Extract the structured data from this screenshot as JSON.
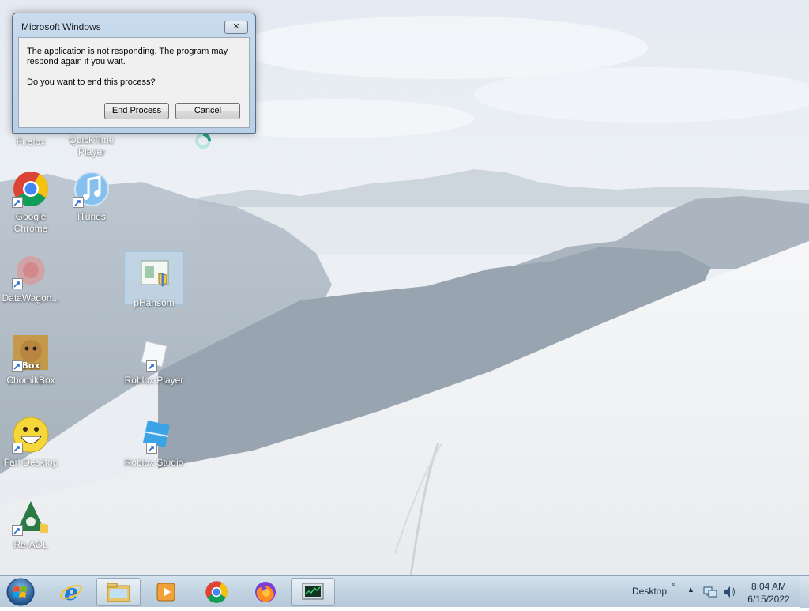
{
  "dialog": {
    "title": "Microsoft Windows",
    "close_label": "✕",
    "message": "The application is not responding. The program may respond again if you wait.",
    "question": "Do you want to end this process?",
    "end_process_label": "End Process",
    "cancel_label": "Cancel"
  },
  "desktop_icons": [
    {
      "label": "Firefox",
      "icon": "firefox-icon"
    },
    {
      "label": "QuickTime Player",
      "icon": "quicktime-icon"
    },
    {
      "label": "Google Chrome",
      "icon": "chrome-icon"
    },
    {
      "label": "iTunes",
      "icon": "itunes-icon"
    },
    {
      "label": "DataWagon...",
      "icon": "datawagon-icon"
    },
    {
      "label": "pHansom",
      "icon": "phansom-icon"
    },
    {
      "label": "ChomikBox",
      "icon": "chomikbox-icon"
    },
    {
      "label": "Roblox Player",
      "icon": "roblox-player-icon"
    },
    {
      "label": "Fart Desktop",
      "icon": "smiley-icon"
    },
    {
      "label": "Roblox Studio",
      "icon": "roblox-studio-icon"
    },
    {
      "label": "Re-AOL",
      "icon": "aol-icon"
    }
  ],
  "taskbar": {
    "pinned": [
      "internet-explorer-icon",
      "file-explorer-icon",
      "media-player-icon",
      "chrome-icon",
      "firefox-icon",
      "task-manager-icon"
    ],
    "tray_desktop_label": "Desktop",
    "tray_chevron": "»",
    "tray_up": "▲",
    "time": "8:04 AM",
    "date": "6/15/2022"
  },
  "colors": {
    "taskbar": "#c3d4e2",
    "dialog_frame": "#b9cfe6",
    "dialog_body": "#f0f0f0"
  }
}
